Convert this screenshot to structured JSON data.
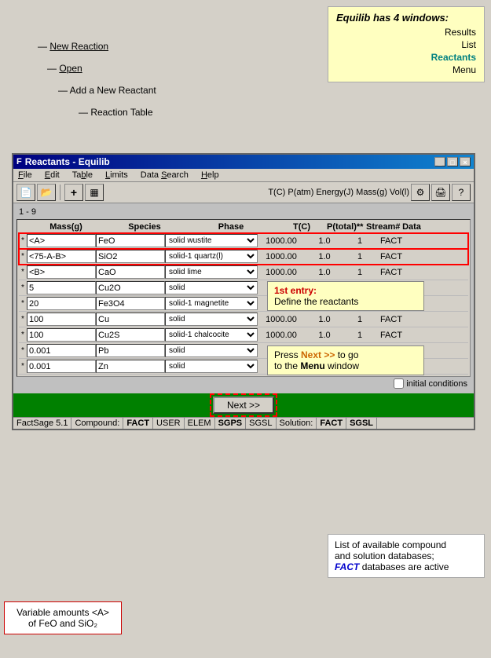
{
  "annotations": {
    "new_reaction": "New Reaction",
    "open": "Open",
    "add_reactant": "Add a New Reactant",
    "reaction_table": "Reaction Table",
    "results": "Results",
    "list": "List",
    "reactants": "Reactants",
    "menu": "Menu"
  },
  "info_box": {
    "title": "Equilib has 4 windows:",
    "windows": [
      "Results",
      "List",
      "Reactants",
      "Menu"
    ]
  },
  "window": {
    "title": "Reactants - Equilib",
    "menu_items": [
      "File",
      "Edit",
      "Table",
      "Limits",
      "Data Search",
      "Help"
    ],
    "toolbar_label": "T(C)  P(atm)  Energy(J)  Mass(g)  Vol(l)",
    "row_indicator": "1 - 9"
  },
  "table": {
    "headers": [
      "Mass(g)",
      "Species",
      "Phase",
      "T(C)",
      "P(total)**",
      "Stream#",
      "Data"
    ],
    "rows": [
      {
        "star": "*",
        "mass": "<A>",
        "species": "FeO",
        "phase": "solid  wustite",
        "tc": "1000.00",
        "ptotal": "1.0",
        "stream": "1",
        "data": "FACT",
        "highlighted": true
      },
      {
        "star": "*",
        "mass": "<75-A-B>",
        "species": "SiO2",
        "phase": "solid-1  quartz(l)",
        "tc": "1000.00",
        "ptotal": "1.0",
        "stream": "1",
        "data": "FACT",
        "highlighted": true
      },
      {
        "star": "*",
        "mass": "<B>",
        "species": "CaO",
        "phase": "solid  lime",
        "tc": "1000.00",
        "ptotal": "1.0",
        "stream": "1",
        "data": "FACT"
      },
      {
        "star": "*",
        "mass": "5",
        "species": "Cu2O",
        "phase": "solid",
        "tc": "",
        "ptotal": "",
        "stream": "",
        "data": ""
      },
      {
        "star": "*",
        "mass": "20",
        "species": "Fe3O4",
        "phase": "solid-1  magnetite",
        "tc": "",
        "ptotal": "",
        "stream": "",
        "data": ""
      },
      {
        "star": "*",
        "mass": "100",
        "species": "Cu",
        "phase": "solid",
        "tc": "1000.00",
        "ptotal": "1.0",
        "stream": "1",
        "data": "FACT"
      },
      {
        "star": "*",
        "mass": "100",
        "species": "Cu2S",
        "phase": "solid-1  chalcocite",
        "tc": "1000.00",
        "ptotal": "1.0",
        "stream": "1",
        "data": "FACT"
      },
      {
        "star": "*",
        "mass": "0.001",
        "species": "Pb",
        "phase": "solid",
        "tc": "",
        "ptotal": "",
        "stream": "",
        "data": ""
      },
      {
        "star": "*",
        "mass": "0.001",
        "species": "Zn",
        "phase": "solid",
        "tc": "",
        "ptotal": "",
        "stream": "",
        "data": ""
      }
    ]
  },
  "callouts": {
    "entry1": "1st entry:",
    "entry1_desc": "Define the reactants",
    "next_desc1": "Press ",
    "next_keyword": "Next >>",
    "next_desc2": " to go",
    "next_desc3": "to the ",
    "menu_keyword": "Menu",
    "next_desc4": " window"
  },
  "next_button": "Next >>",
  "status_bar": {
    "items": [
      "FactSage 5.1",
      "Compound:",
      "FACT",
      "USER",
      "ELEM",
      "SGPS",
      "SGSL",
      "Solution:",
      "FACT",
      "SGSL"
    ]
  },
  "bottom_annotations": {
    "databases": "List of available compound\nand solution databases;\nFACT databases are active",
    "variable": "Variable amounts <A>\nof FeO and SiO2"
  },
  "initial_conditions": "initial conditions"
}
